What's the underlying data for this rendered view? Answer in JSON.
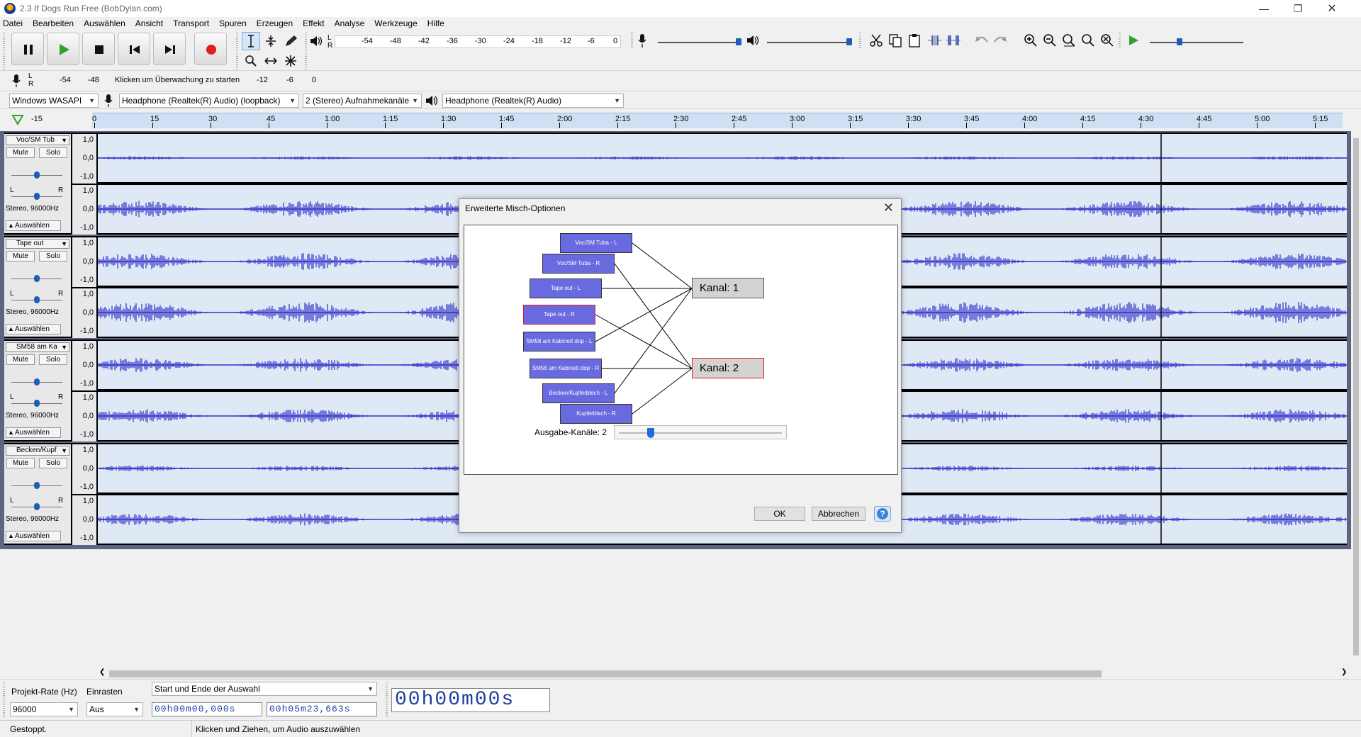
{
  "window": {
    "title": "2.3 If Dogs Run Free (BobDylan.com)"
  },
  "menu": [
    "Datei",
    "Bearbeiten",
    "Auswählen",
    "Ansicht",
    "Transport",
    "Spuren",
    "Erzeugen",
    "Effekt",
    "Analyse",
    "Werkzeuge",
    "Hilfe"
  ],
  "meters": {
    "play_ticks": [
      "-54",
      "-48",
      "-42",
      "-36",
      "-30",
      "-24",
      "-18",
      "-12",
      "-6",
      "0"
    ],
    "rec_ticks": [
      "-54",
      "-48"
    ],
    "rec_ticks2": [
      "-12",
      "-6",
      "0"
    ],
    "monitor_text": "Klicken um Überwachung zu starten",
    "lr": [
      "L",
      "R"
    ]
  },
  "device": {
    "host": "Windows WASAPI",
    "input": "Headphone (Realtek(R) Audio) (loopback)",
    "channels": "2 (Stereo) Aufnahmekanäle",
    "output": "Headphone (Realtek(R) Audio)"
  },
  "ruler": [
    "-15",
    "0",
    "15",
    "30",
    "45",
    "1:00",
    "1:15",
    "1:30",
    "1:45",
    "2:00",
    "2:15",
    "2:30",
    "2:45",
    "3:00",
    "3:15",
    "3:30",
    "3:45",
    "4:00",
    "4:15",
    "4:30",
    "4:45",
    "5:00",
    "5:15"
  ],
  "tracks": [
    {
      "name": "Voc/SM Tub",
      "mute": "Mute",
      "solo": "Solo",
      "info": "Stereo, 96000Hz",
      "select": "Auswählen"
    },
    {
      "name": "Tape out",
      "mute": "Mute",
      "solo": "Solo",
      "info": "Stereo, 96000Hz",
      "select": "Auswählen"
    },
    {
      "name": "SM58 am Ka",
      "mute": "Mute",
      "solo": "Solo",
      "info": "Stereo, 96000Hz",
      "select": "Auswählen"
    },
    {
      "name": "Becken/Kupf",
      "mute": "Mute",
      "solo": "Solo",
      "info": "Stereo, 96000Hz",
      "select": "Auswählen"
    }
  ],
  "vscale": [
    "1,0",
    "0,0",
    "-1,0"
  ],
  "pan_lr": [
    "L",
    "R"
  ],
  "dialog": {
    "title": "Erweiterte Misch-Optionen",
    "inputs": [
      "Voc/SM Tuba - L",
      "Voc/SM Tuba - R",
      "Tape out - L",
      "Tape out - R",
      "SM58 am Kabinett dop - L",
      "SM58 am Kabinett dop - R",
      "Becken/Kupferblech - L",
      "Kupferblech - R"
    ],
    "outputs": [
      "Kanal:  1",
      "Kanal:  2"
    ],
    "output_channels_label": "Ausgabe-Kanäle:  2",
    "ok": "OK",
    "cancel": "Abbrechen",
    "help": "?"
  },
  "bottom": {
    "rate_label": "Projekt-Rate (Hz)",
    "snap_label": "Einrasten",
    "rate_value": "96000",
    "snap_value": "Aus",
    "sel_mode": "Start und Ende der Auswahl",
    "sel_start": "00h00m00,000s",
    "sel_end": "00h05m23,663s",
    "big_time": "00h00m00s"
  },
  "status": {
    "left": "Gestoppt.",
    "hint": "Klicken und Ziehen, um Audio auszuwählen"
  },
  "colors": {
    "wave": "#3232c8",
    "wave_bg": "#dfe8f5",
    "node": "#6a6ae0",
    "record": "#e01e1e",
    "play": "#2fa12f"
  }
}
